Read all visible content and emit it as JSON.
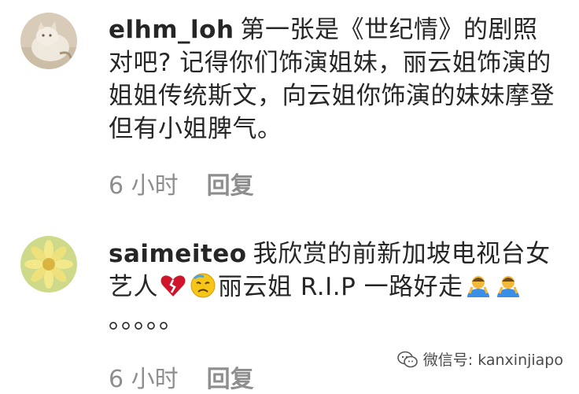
{
  "comments": [
    {
      "username": "elhm_loh",
      "text": "第一张是《世纪情》的剧照对吧? 记得你们饰演姐妹，丽云姐饰演的姐姐传统斯文，向云姐你饰演的妹妹摩登但有小姐脾气。",
      "time": "6 小时",
      "reply_label": "回复",
      "avatar_icon": "cat-avatar-icon"
    },
    {
      "username": "saimeiteo",
      "text_part1": "我欣赏的前新加坡电视台女艺人",
      "text_part2": "丽云姐 R.I.P 一路好走",
      "text_part3": "。。。。。",
      "time": "6 小时",
      "reply_label": "回复",
      "avatar_icon": "flower-avatar-icon",
      "emojis": [
        "broken-heart-icon",
        "sad-face-icon",
        "person-bowing-icon"
      ]
    }
  ],
  "watermark": {
    "text": "微信号: kanxinjiapo",
    "icon": "wechat-icon"
  },
  "colors": {
    "text": "#262626",
    "meta": "#8e8e8e",
    "broken_heart": "#d0142c",
    "emoji_yellow": "#f5c518"
  }
}
